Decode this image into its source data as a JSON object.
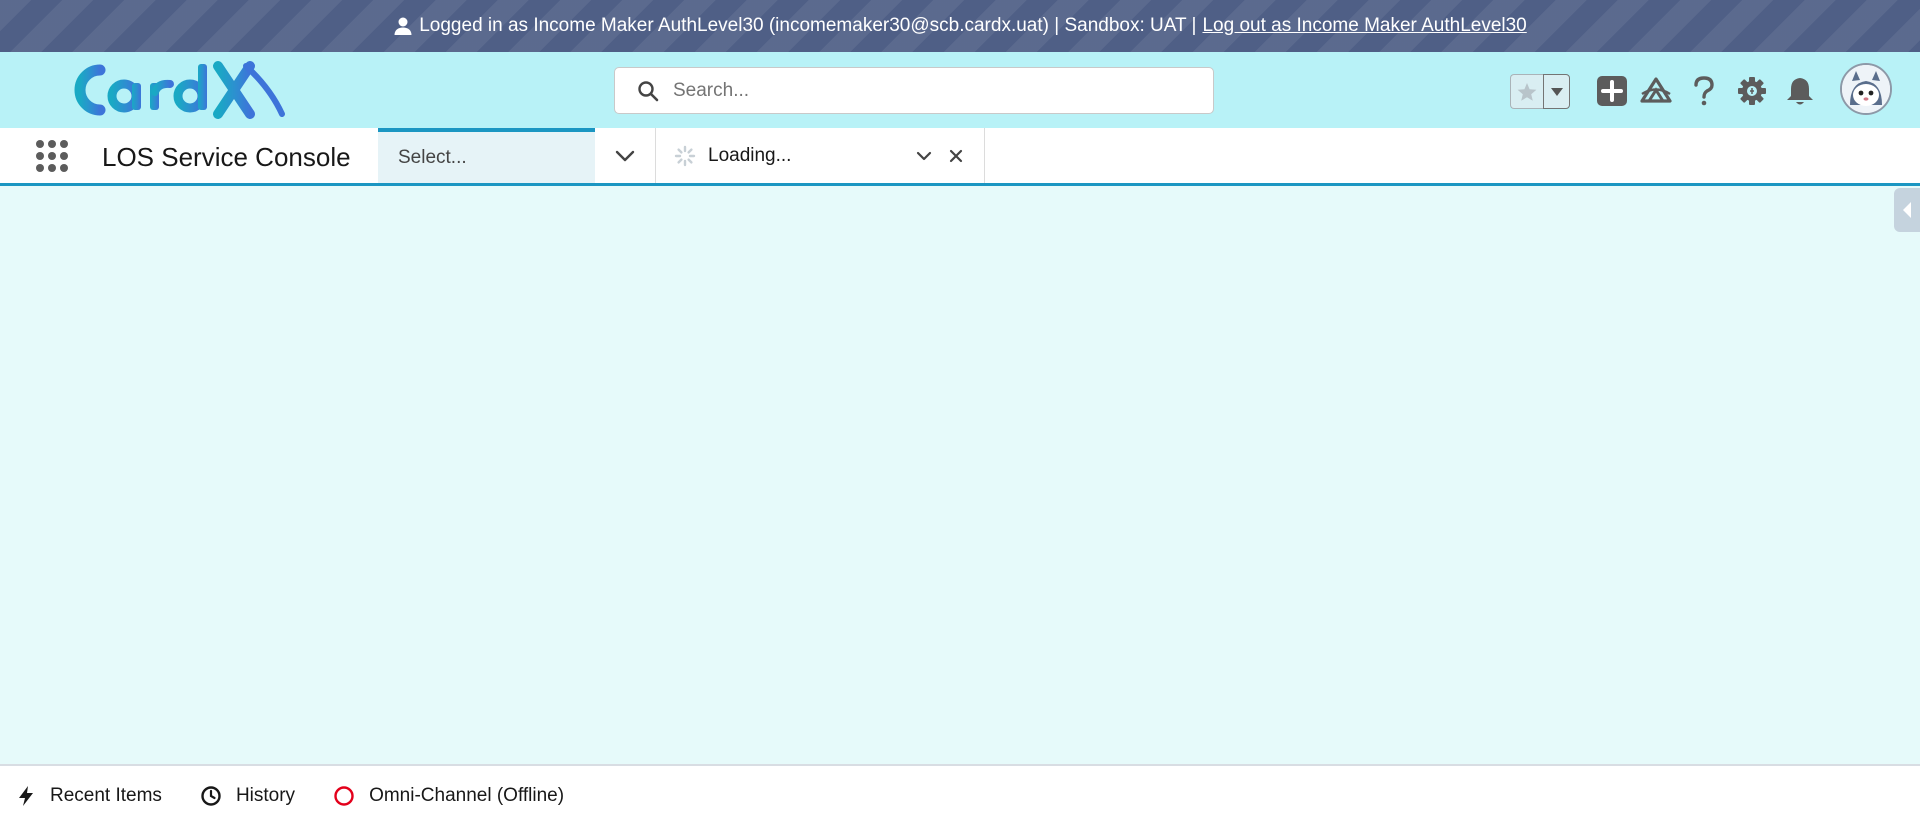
{
  "banner": {
    "text": "Logged in as Income Maker AuthLevel30 (incomemaker30@scb.cardx.uat) | Sandbox: UAT |",
    "logout_link": "Log out as Income Maker AuthLevel30",
    "color": "#4f5f86"
  },
  "header": {
    "logo_text": "CardX",
    "search_placeholder": "Search...",
    "background": "#b8f2f7",
    "icons": [
      "favorites-star-icon",
      "favorites-menu-icon",
      "global-actions-add-icon",
      "trailhead-icon",
      "help-icon",
      "setup-gear-icon",
      "notifications-bell-icon",
      "user-avatar"
    ]
  },
  "navbar": {
    "app_name": "LOS Service Console",
    "select_placeholder": "Select...",
    "tabs": [
      {
        "label": "Loading..."
      }
    ],
    "accent": "#1b96c2"
  },
  "utility_bar": {
    "items": [
      {
        "label": "Recent Items",
        "icon": "lightning-icon"
      },
      {
        "label": "History",
        "icon": "clock-icon"
      },
      {
        "label": "Omni-Channel (Offline)",
        "icon": "offline-status-icon",
        "status_color": "#e3001b"
      }
    ]
  }
}
